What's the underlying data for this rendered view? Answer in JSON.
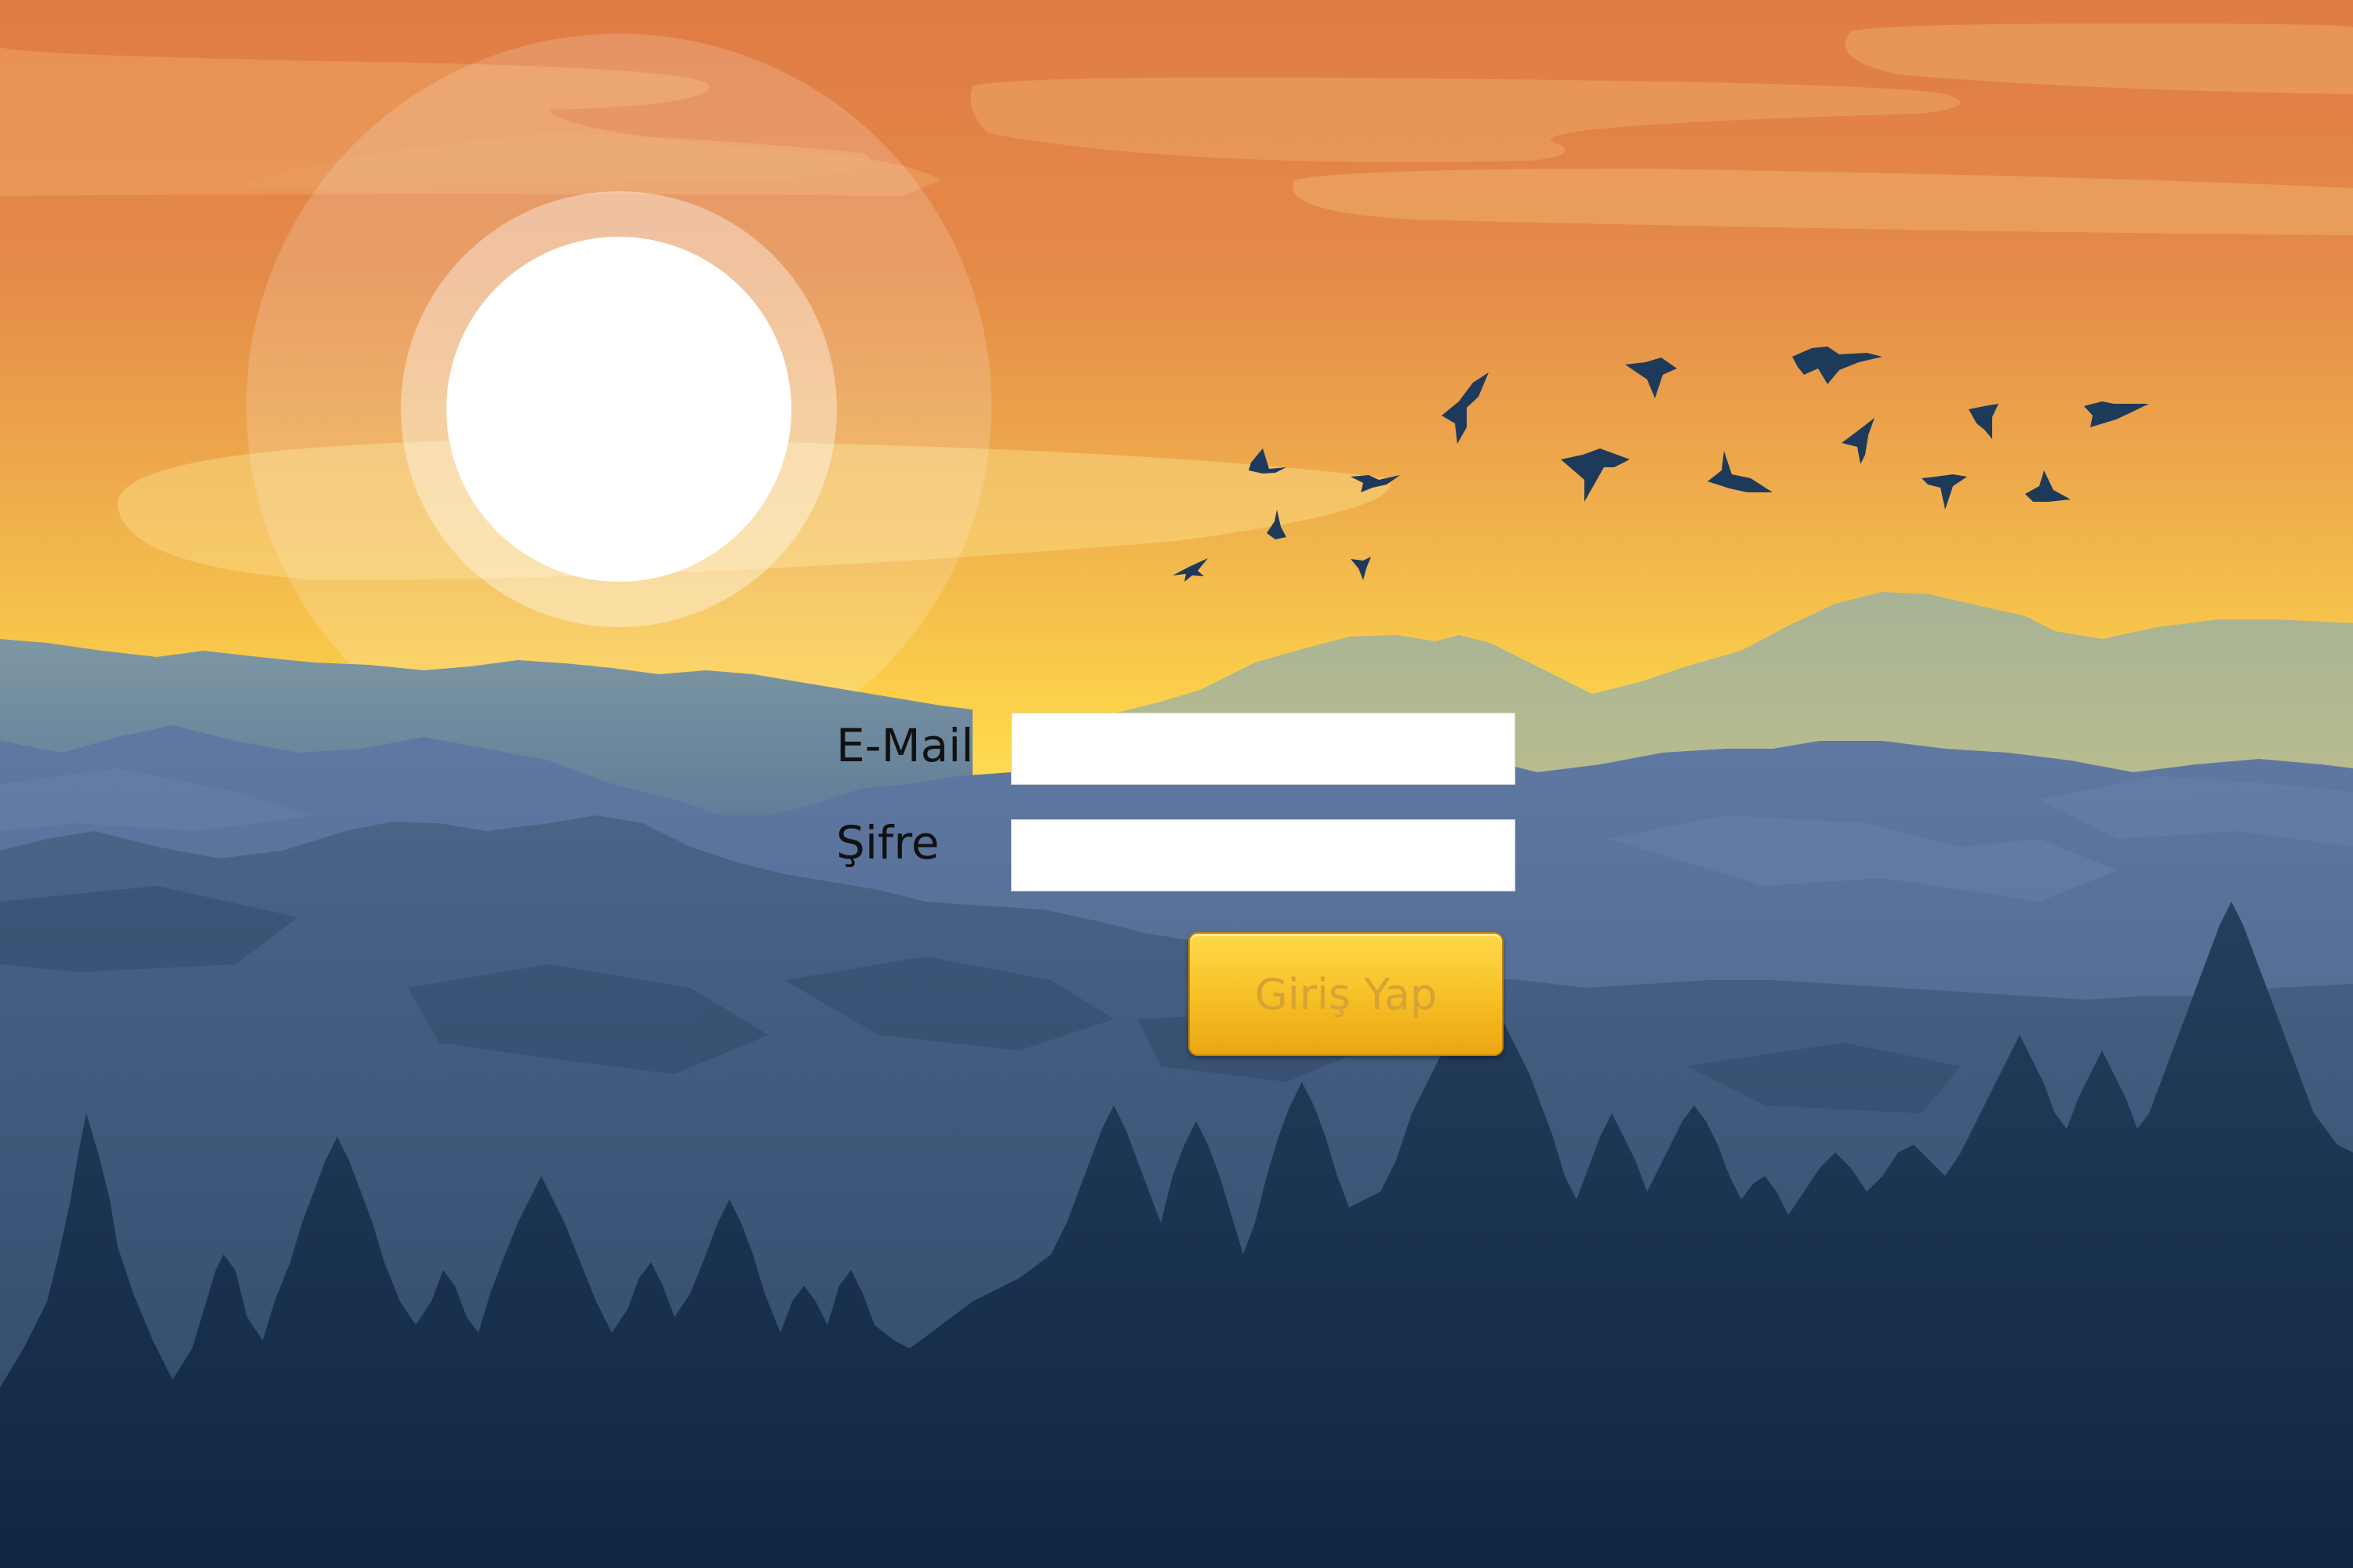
{
  "login_form": {
    "email_label": "E-Mail",
    "email_value": "",
    "password_label": "Şifre",
    "password_value": "",
    "submit_label": "Giriş Yap"
  },
  "colors": {
    "sky_top": "#e07c45",
    "sky_mid": "#ebab4e",
    "sky_glow": "#fde06b",
    "sun": "#ffffff",
    "birds": "#1e3a5a",
    "far_hills": "#afb88f",
    "mid_mountains": "#5c77a0",
    "near_mountains": "#3f5a80",
    "forest": "#1b3550",
    "button": "#f6b81c"
  }
}
